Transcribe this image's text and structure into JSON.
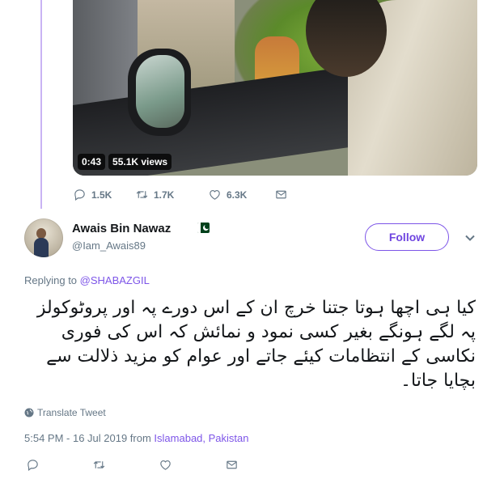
{
  "video": {
    "duration": "0:43",
    "views": "55.1K views"
  },
  "top_actions": {
    "replies": "1.5K",
    "retweets": "1.7K",
    "likes": "6.3K"
  },
  "reply_tweet": {
    "display_name": "Awais Bin Nawaz",
    "handle": "@Iam_Awais89",
    "follow_label": "Follow",
    "replying_prefix": "Replying to ",
    "replying_to": "@SHABAZGIL",
    "text": "کیا ہی اچھا ہوتا جتنا خرچ ان کے اس دورے پہ اور پروٹوکولز پہ لگے ہونگے بغیر کسی نمود و نمائش کہ اس کی فوری نکاسی کے انتظامات کیئے جاتے اور عوام کو مزید ذلالت سے بچایا جاتا۔",
    "translate_label": "Translate Tweet",
    "timestamp": "5:54 PM - 16 Jul 2019 from ",
    "location": "Islamabad, Pakistan"
  },
  "colors": {
    "accent": "#7d55e8",
    "muted": "#657786",
    "thread_line": "#c9b3f4"
  },
  "icons": [
    "reply-icon",
    "retweet-icon",
    "like-icon",
    "dm-icon",
    "chevron-down-icon",
    "globe-icon",
    "pakistan-flag-icon"
  ]
}
